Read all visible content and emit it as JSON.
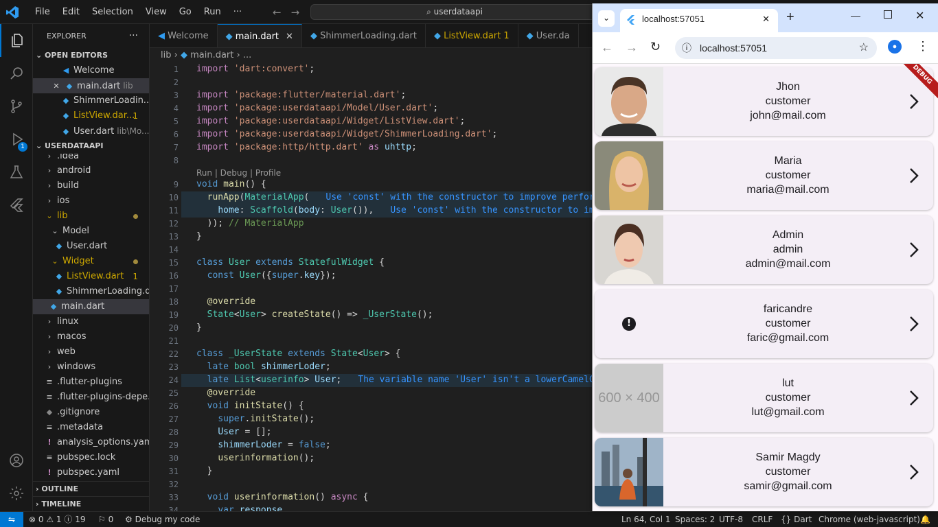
{
  "titlebar": {
    "menu": [
      "File",
      "Edit",
      "Selection",
      "View",
      "Go",
      "Run",
      "···"
    ],
    "search": "userdataapi"
  },
  "explorer": {
    "title": "EXPLORER",
    "open_editors": "OPEN EDITORS",
    "workspace": "USERDATAAPI",
    "outline": "OUTLINE",
    "timeline": "TIMELINE",
    "open_items": [
      {
        "label": "Welcome",
        "sub": ""
      },
      {
        "label": "main.dart",
        "sub": "lib"
      },
      {
        "label": "ShimmerLoadin...",
        "sub": ""
      },
      {
        "label": "ListView.dar...",
        "sub": "",
        "count": "1"
      },
      {
        "label": "User.dart",
        "sub": "lib\\Mo..."
      }
    ],
    "tree": [
      ".idea",
      "android",
      "build",
      "ios",
      "lib",
      "Model",
      "User.dart",
      "Widget",
      "ListView.dart",
      "ShimmerLoading.d...",
      "main.dart",
      "linux",
      "macos",
      "web",
      "windows",
      ".flutter-plugins",
      ".flutter-plugins-depe...",
      ".gitignore",
      ".metadata",
      "analysis_options.yaml",
      "pubspec.lock",
      "pubspec.yaml"
    ],
    "listview_count": "1"
  },
  "tabs": [
    {
      "label": "Welcome"
    },
    {
      "label": "main.dart"
    },
    {
      "label": "ShimmerLoading.dart"
    },
    {
      "label": "ListView.dart 1"
    },
    {
      "label": "User.da"
    }
  ],
  "breadcrumb": {
    "folder": "lib",
    "file": "main.dart",
    "rest": "..."
  },
  "editor": {
    "codelens": "Run | Debug | Profile",
    "line_numbers": [
      "1",
      "2",
      "3",
      "4",
      "5",
      "6",
      "7",
      "8",
      "9",
      "10",
      "11",
      "12",
      "13",
      "14",
      "15",
      "16",
      "17",
      "18",
      "19",
      "20",
      "21",
      "22",
      "23",
      "24",
      "25",
      "26",
      "27",
      "28",
      "29",
      "30",
      "31",
      "32",
      "33",
      "34"
    ],
    "hints": {
      "l10": "Use 'const' with the constructor to improve perfor",
      "l11": "Use 'const' with the constructor to im",
      "l24": "The variable name 'User' isn't a lowerCamelC"
    }
  },
  "statusbar": {
    "errors": "0",
    "warnings": "1",
    "infos": "19",
    "ports": "0",
    "debug": "Debug my code",
    "position": "Ln 64, Col 1",
    "spaces": "Spaces: 2",
    "encoding": "UTF-8",
    "eol": "CRLF",
    "language": "Dart",
    "device": "Chrome (web-javascript)"
  },
  "browser": {
    "tab_title": "localhost:57051",
    "url": "localhost:57051",
    "debug_banner": "DEBUG",
    "users": [
      {
        "name": "Jhon",
        "role": "customer",
        "email": "john@mail.com",
        "avatar": "man-photo"
      },
      {
        "name": "Maria",
        "role": "customer",
        "email": "maria@mail.com",
        "avatar": "woman-blonde-photo"
      },
      {
        "name": "Admin",
        "role": "admin",
        "email": "admin@mail.com",
        "avatar": "woman-brunette-photo"
      },
      {
        "name": "faricandre",
        "role": "customer",
        "email": "faric@gmail.com",
        "avatar": "error-icon"
      },
      {
        "name": "lut",
        "role": "customer",
        "email": "lut@gmail.com",
        "avatar": "placeholder",
        "placeholder_text": "600 × 400"
      },
      {
        "name": "Samir Magdy",
        "role": "customer",
        "email": "samir@gmail.com",
        "avatar": "city-photo"
      }
    ]
  },
  "colors": {
    "accent": "#0078d4",
    "editor_bg": "#1f1f1f",
    "sidebar_bg": "#181818",
    "card_bg": "#f4eef6",
    "debug_banner": "#b71c1c"
  }
}
